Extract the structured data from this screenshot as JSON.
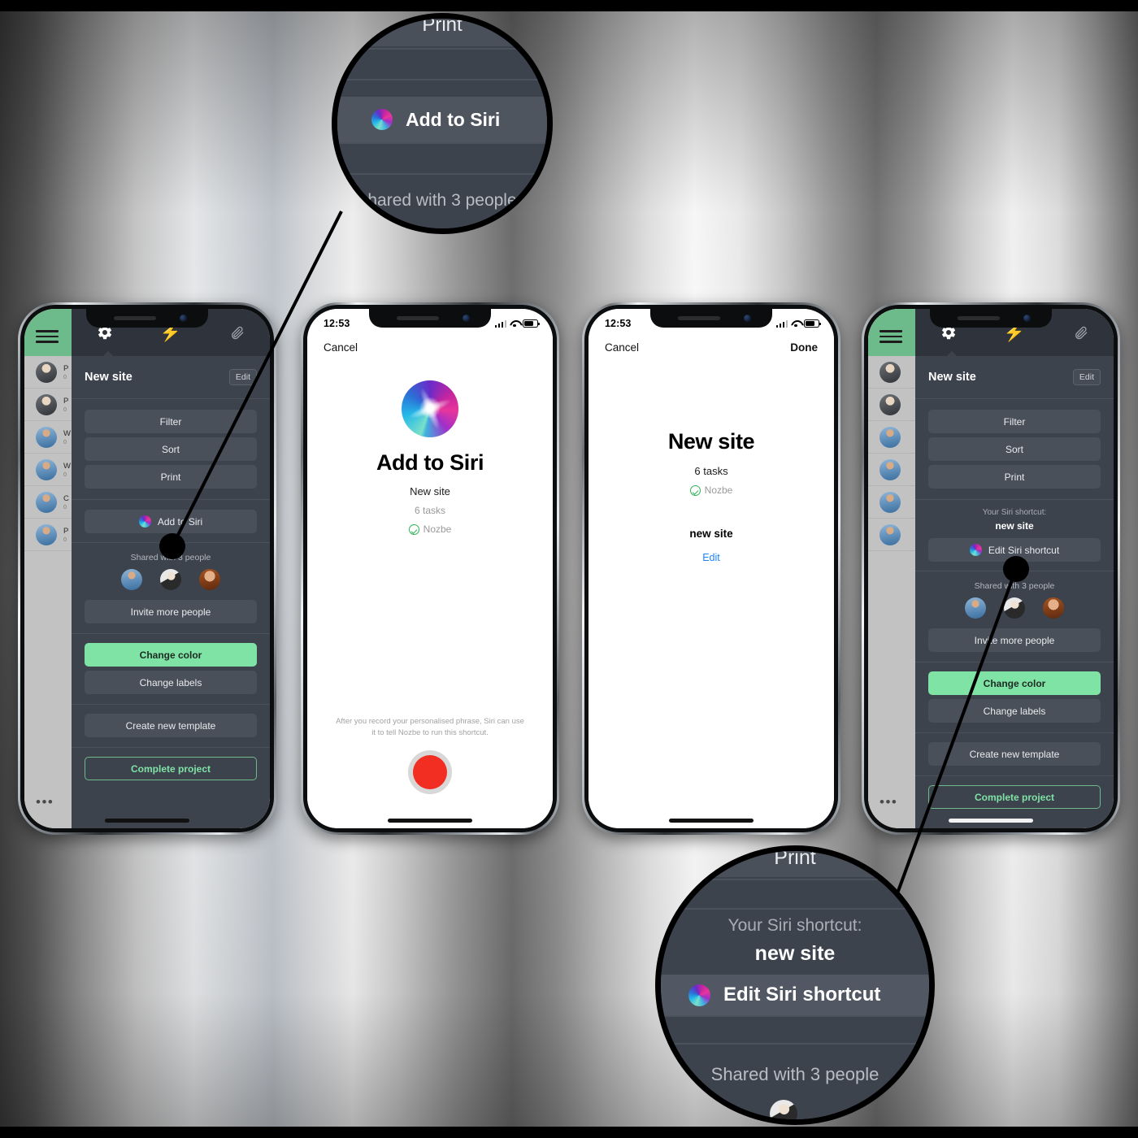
{
  "background": {
    "style": "metallic-silver-gradient",
    "border_color": "#000000"
  },
  "colors": {
    "overlay_bg": "#3d434d",
    "overlay_tabbar": "#2f343c",
    "button_bg": "#4a505a",
    "accent_green": "#7fe3a6",
    "brand_green": "#6dba8a",
    "link_blue": "#1b84ff",
    "record_red": "#f22d22"
  },
  "phones": [
    {
      "id": "phone-1-project-settings",
      "status_bar": {
        "time": "",
        "visible": false
      },
      "tabs": [
        {
          "name": "settings-tab",
          "icon": "gear-icon",
          "active": true
        },
        {
          "name": "actions-tab",
          "icon": "bolt-icon",
          "active": false
        },
        {
          "name": "attachments-tab",
          "icon": "paperclip-icon",
          "active": false
        }
      ],
      "header": {
        "title": "New site",
        "edit_label": "Edit"
      },
      "buttons": [
        {
          "name": "filter-button",
          "label": "Filter"
        },
        {
          "name": "sort-button",
          "label": "Sort"
        },
        {
          "name": "print-button",
          "label": "Print"
        }
      ],
      "siri_row": {
        "label": "Add to Siri",
        "icon": "siri-icon"
      },
      "sharing": {
        "label": "Shared with 3 people",
        "avatars": [
          "avatar-1",
          "avatar-2",
          "avatar-3"
        ],
        "invite_label": "Invite more people"
      },
      "actions": [
        {
          "name": "change-color-button",
          "label": "Change color",
          "style": "green"
        },
        {
          "name": "change-labels-button",
          "label": "Change labels",
          "style": "default"
        },
        {
          "name": "create-new-template-button",
          "label": "Create new template",
          "style": "default"
        },
        {
          "name": "complete-project-button",
          "label": "Complete project",
          "style": "outline"
        }
      ],
      "list_behind": [
        {
          "title": "P",
          "sub": "0"
        },
        {
          "title": "P",
          "sub": "0"
        },
        {
          "title": "W",
          "sub": "0"
        },
        {
          "title": "W",
          "sub": "0"
        },
        {
          "title": "C",
          "sub": "0"
        },
        {
          "title": "P",
          "sub": "0"
        }
      ],
      "more_dots": "•••"
    },
    {
      "id": "phone-2-add-to-siri",
      "status_bar": {
        "time": "12:53",
        "visible": true
      },
      "nav": {
        "cancel": "Cancel",
        "done": ""
      },
      "icon": "siri-orb-icon",
      "title": "Add to Siri",
      "subtitle": "New site",
      "tasks": "6 tasks",
      "app_name": "Nozbe",
      "hint": "After you record your personalised phrase, Siri can use it to tell Nozbe to run this shortcut.",
      "record_button": "record-button"
    },
    {
      "id": "phone-3-siri-shortcut-created",
      "status_bar": {
        "time": "12:53",
        "visible": true
      },
      "nav": {
        "cancel": "Cancel",
        "done": "Done"
      },
      "title": "New site",
      "tasks": "6 tasks",
      "app_name": "Nozbe",
      "phrase": "new site",
      "edit_label": "Edit"
    },
    {
      "id": "phone-4-project-settings-with-shortcut",
      "status_bar": {
        "time": "",
        "visible": false
      },
      "tabs": [
        {
          "name": "settings-tab",
          "icon": "gear-icon",
          "active": true
        },
        {
          "name": "actions-tab",
          "icon": "bolt-icon",
          "active": false
        },
        {
          "name": "attachments-tab",
          "icon": "paperclip-icon",
          "active": false
        }
      ],
      "header": {
        "title": "New site",
        "edit_label": "Edit"
      },
      "buttons": [
        {
          "name": "filter-button",
          "label": "Filter"
        },
        {
          "name": "sort-button",
          "label": "Sort"
        },
        {
          "name": "print-button",
          "label": "Print"
        }
      ],
      "siri_section": {
        "caption": "Your Siri shortcut:",
        "value": "new site",
        "edit_label": "Edit Siri shortcut",
        "icon": "siri-icon"
      },
      "sharing": {
        "label": "Shared with 3 people",
        "avatars": [
          "avatar-1",
          "avatar-2",
          "avatar-3"
        ],
        "invite_label": "Invite more people"
      },
      "actions": [
        {
          "name": "change-color-button",
          "label": "Change color",
          "style": "green"
        },
        {
          "name": "change-labels-button",
          "label": "Change labels",
          "style": "default"
        },
        {
          "name": "create-new-template-button",
          "label": "Create new template",
          "style": "default"
        },
        {
          "name": "complete-project-button",
          "label": "Complete project",
          "style": "outline"
        }
      ],
      "more_dots": "•••"
    }
  ],
  "callouts": [
    {
      "id": "callout-top-add-to-siri",
      "lines": [
        "Print",
        "Add to Siri",
        "hared with 3 people"
      ],
      "highlight": "Add to Siri",
      "icon": "siri-icon"
    },
    {
      "id": "callout-bottom-edit-siri-shortcut",
      "lines": [
        "Print",
        "Your Siri shortcut:",
        "new site",
        "Edit Siri shortcut",
        "Shared with 3 people"
      ],
      "highlight": "Edit Siri shortcut",
      "icon": "siri-icon"
    }
  ]
}
